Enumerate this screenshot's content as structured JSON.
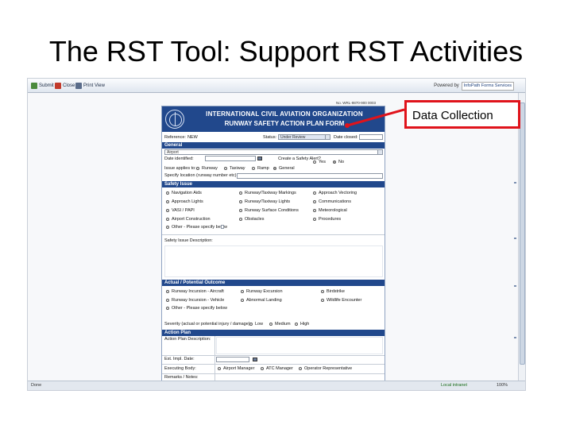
{
  "slide": {
    "title": "The RST Tool: Support RST Activities"
  },
  "toolbar": {
    "submit": "Submit",
    "close": "Close",
    "print": "Print View",
    "powered_by": "Powered by",
    "infopath": "InfoPath Forms Services"
  },
  "form": {
    "ref_number": "No. WRL-9870-900 0003",
    "org": "INTERNATIONAL CIVIL AVIATION ORGANIZATION",
    "name": "RUNWAY SAFETY ACTION PLAN FORM",
    "reference_label": "Reference:",
    "reference_value": "NEW",
    "status_label": "Status:",
    "status_value": "Under Review",
    "date_closed_label": "Date closed:",
    "general_header": "General",
    "airport_value": "Airport",
    "date_identified_label": "Date identified:",
    "create_alert_label": "Create a Safety Alert?",
    "yes": "Yes",
    "no": "No",
    "issue_applies_label": "Issue applies to:",
    "applies": [
      "Runway",
      "Taxiway",
      "Ramp",
      "General"
    ],
    "specify_location": "Specify location (runway number etc):",
    "safety_issue_header": "Safety Issue",
    "issues_col1": [
      "Navigation Aids",
      "Approach Lights",
      "VASI / PAPI",
      "Airport Construction",
      "Other - Please specify below"
    ],
    "issues_col2": [
      "Runway/Taxiway Markings",
      "Runway/Taxiway Lights",
      "Runway Surface Conditions",
      "Obstacles"
    ],
    "issues_col3": [
      "Approach Vectoring",
      "Communications",
      "Meteorological",
      "Procedures"
    ],
    "issue_desc_label": "Safety Issue Description:",
    "outcome_header": "Actual / Potential Outcome",
    "outcomes_col1": [
      "Runway Incursion - Aircraft",
      "Runway Incursion - Vehicle",
      "Other - Please specify below"
    ],
    "outcomes_col2": [
      "Runway Excursion",
      "Abnormal Landing"
    ],
    "outcomes_col3": [
      "Birdstrike",
      "Wildlife Encounter"
    ],
    "severity_label": "Severity (actual or potential injury / damage):",
    "severity": [
      "Low",
      "Medium",
      "High"
    ],
    "action_plan_header": "Action Plan",
    "action_desc_label": "Action Plan Description:",
    "est_impl_label": "Est. Impl. Date:",
    "executing_label": "Executing Body:",
    "executing": [
      "Airport Manager",
      "ATC Manager",
      "Operator Representative"
    ],
    "remarks_label": "Remarks / Notes:"
  },
  "statusbar": {
    "done": "Done",
    "zone": "Local intranet",
    "zoom": "100%"
  },
  "callout": {
    "text": "Data Collection",
    "color": "#e0131b"
  }
}
